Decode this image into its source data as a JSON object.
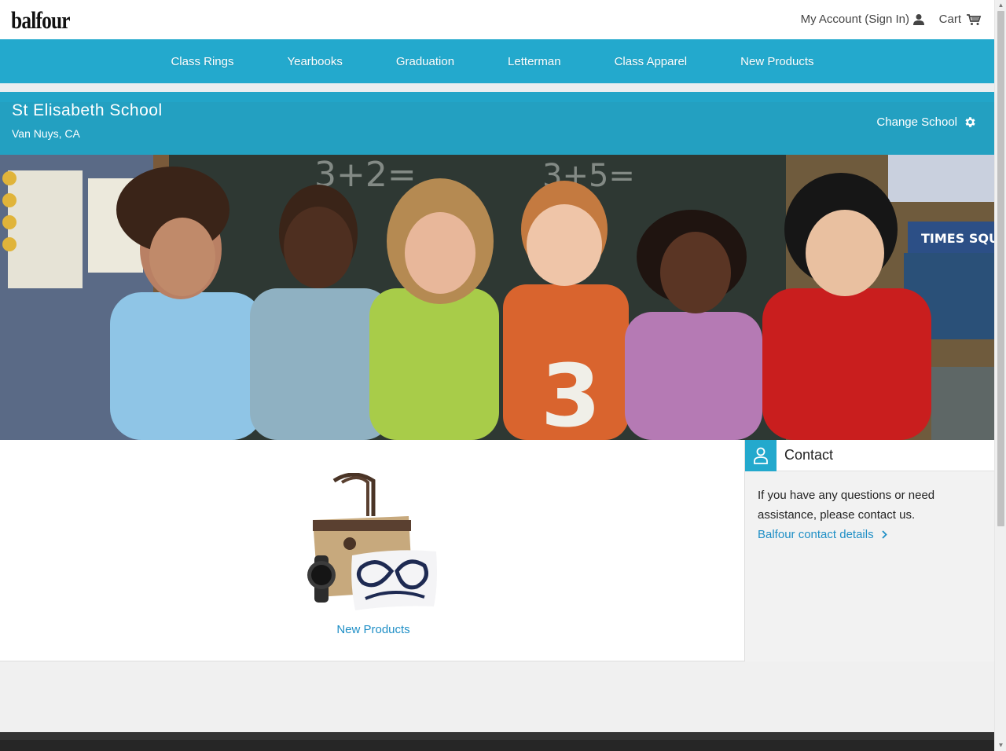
{
  "header": {
    "logo": "balfour",
    "account_label": "My Account (Sign In)",
    "cart_label": "Cart"
  },
  "nav": {
    "items": [
      "Class Rings",
      "Yearbooks",
      "Graduation",
      "Letterman",
      "Class Apparel",
      "New Products"
    ]
  },
  "school": {
    "name": "St Elisabeth School",
    "location": "Van Nuys, CA",
    "change_label": "Change School"
  },
  "products": {
    "tile_label": "New Products"
  },
  "contact": {
    "title": "Contact",
    "body": "If you have any questions or need assistance, please contact us.",
    "link": "Balfour contact details"
  },
  "hero_image": {
    "jersey_number": "3",
    "chalk_text": "3+2= 3+5=",
    "sign_text": "TIMES SQU"
  },
  "colors": {
    "brand_blue": "#23a9cd",
    "link_blue": "#1f8fc6",
    "footer_dark": "#262626"
  },
  "icons": {
    "account": "user-icon",
    "cart": "cart-icon",
    "change_school": "gear-icon",
    "contact": "person-icon",
    "contact_link": "chevron-right-icon"
  }
}
